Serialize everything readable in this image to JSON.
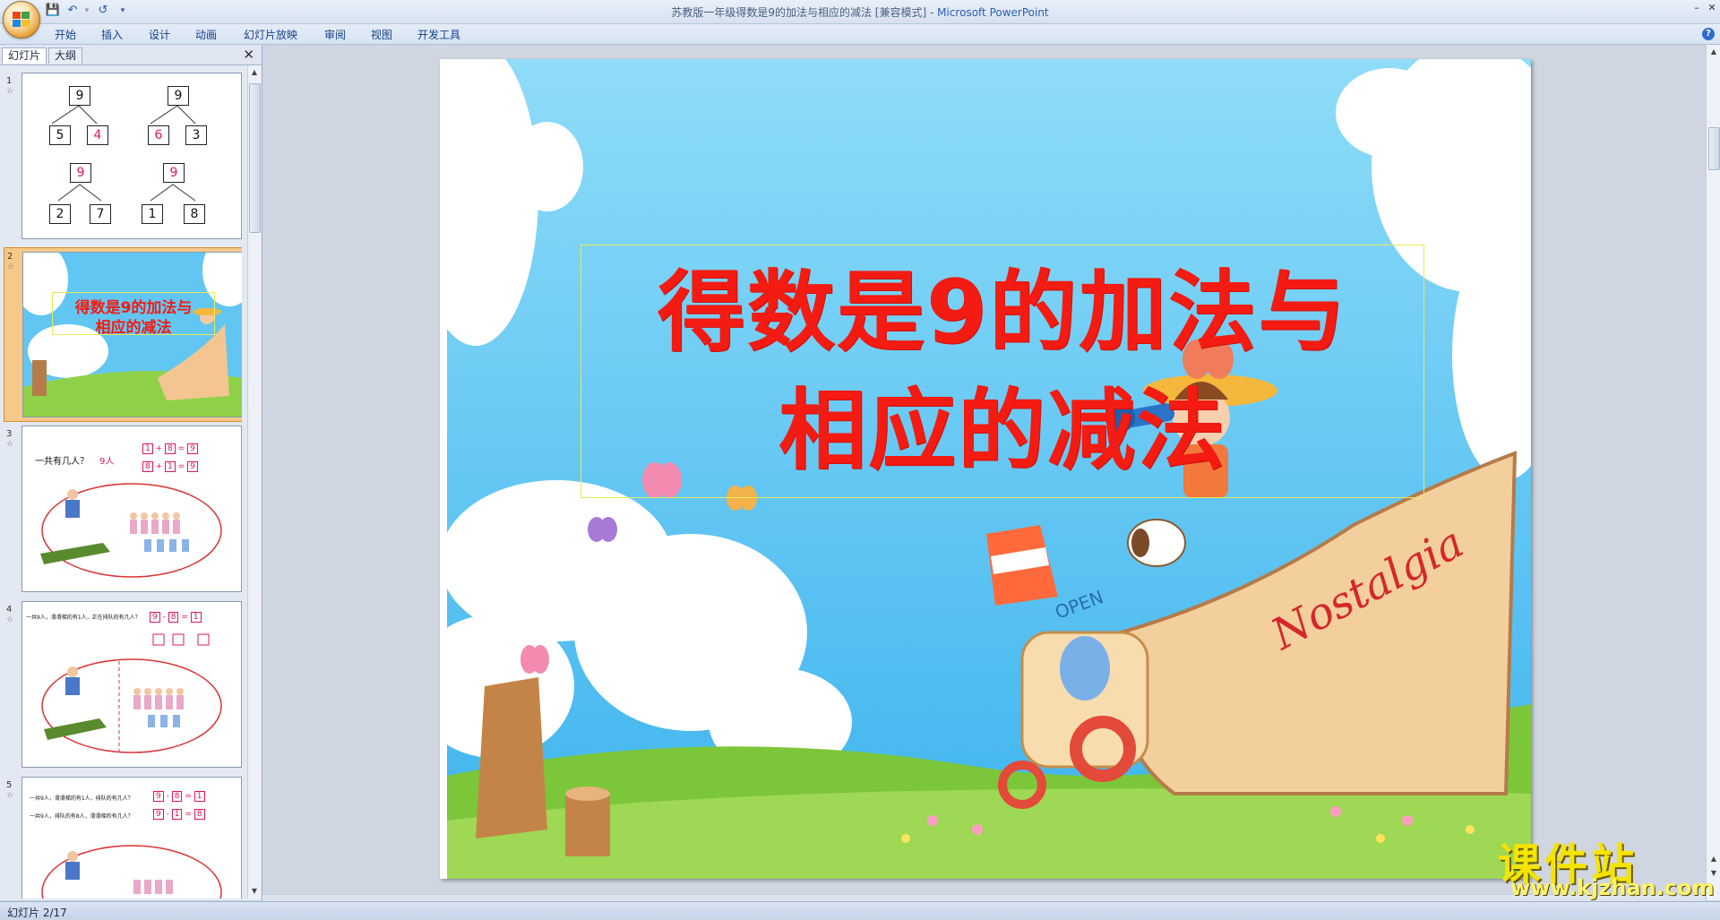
{
  "window": {
    "title": "苏教版一年级得数是9的加法与相应的减法 [兼容模式] - ",
    "app_name": "Microsoft PowerPoint"
  },
  "ribbon": {
    "tabs": [
      "开始",
      "插入",
      "设计",
      "动画",
      "幻灯片放映",
      "审阅",
      "视图",
      "开发工具"
    ]
  },
  "panel": {
    "tab_slides": "幻灯片",
    "tab_outline": "大纲"
  },
  "thumbnails": {
    "t1": {
      "num": "1",
      "top": [
        "9",
        "5",
        "4",
        "9",
        "6",
        "3"
      ],
      "bottom": [
        "9",
        "2",
        "7",
        "9",
        "1",
        "8"
      ]
    },
    "t2": {
      "num": "2",
      "line1": "得数是9的加法与",
      "line2": "相应的减法"
    },
    "t3": {
      "num": "3",
      "question": "一共有几人？",
      "answer": "9人",
      "eq1": [
        "1",
        "+",
        "8",
        "=",
        "9"
      ],
      "eq2": [
        "8",
        "+",
        "1",
        "=",
        "9"
      ]
    },
    "t4": {
      "num": "4",
      "question": "一共9人，滑滑梯的有1人，正在排队的有几人？",
      "eq1": [
        "9",
        "-",
        "8",
        "=",
        "1"
      ]
    },
    "t5": {
      "num": "5",
      "q1": "一共9人，滑滑梯的有1人，排队的有几人？",
      "q2": "一共9人，排队的有8人，滑滑梯的有几人？",
      "eq1": [
        "9",
        "-",
        "8",
        "=",
        "1"
      ],
      "eq2": [
        "9",
        "-",
        "1",
        "=",
        "8"
      ]
    }
  },
  "slide": {
    "title_line1": "得数是9的加法与",
    "title_line2": "相应的减法",
    "boat_label": "Nostalgia",
    "sign_label": "OPEN"
  },
  "status": {
    "slide_indicator": "幻灯片 2/17"
  },
  "watermark": {
    "name": "课件站",
    "url": "www.kjzhan.com"
  },
  "colors": {
    "title_red": "#f31b12",
    "sky_blue": "#5bc3f1",
    "grass_green": "#7cc63a",
    "selection_orange": "#f5c98a"
  }
}
